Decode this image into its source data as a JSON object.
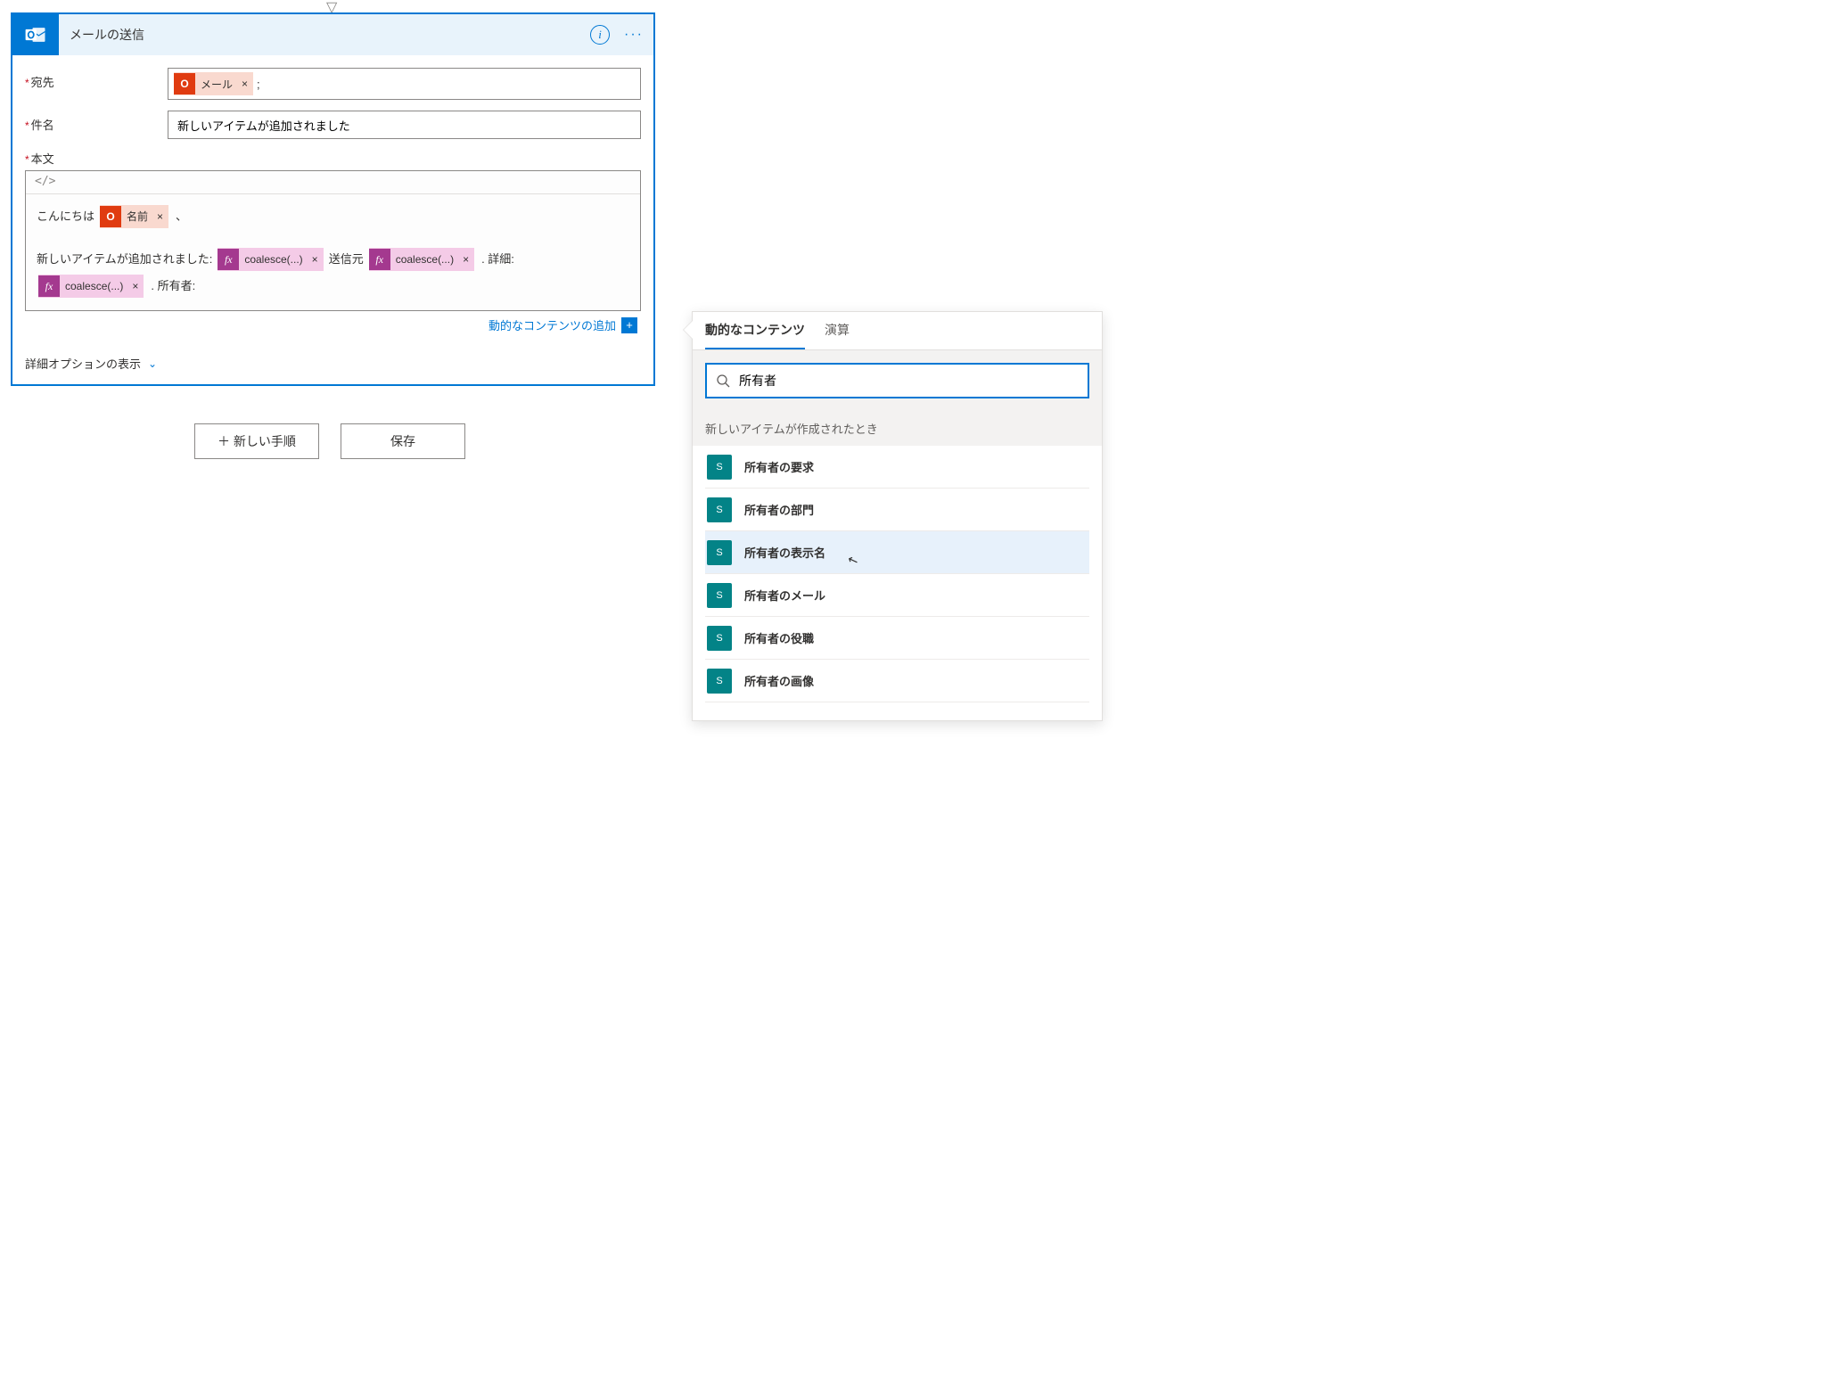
{
  "arrow_char": "▽",
  "action": {
    "title": "メールの送信",
    "info_content": "i",
    "menu_dots": "···",
    "labels": {
      "to": "宛先",
      "subject": "件名",
      "body": "本文"
    },
    "to_token": {
      "label": "メール"
    },
    "to_suffix": ";",
    "subject_value": "新しいアイテムが追加されました",
    "body": {
      "toolbar_code": "</>",
      "line1_prefix": "こんにちは",
      "line1_token": "名前",
      "line1_suffix": "、",
      "line2_prefix": "新しいアイテムが追加されました:",
      "line2_fx1": "coalesce(...)",
      "line2_mid": "送信元",
      "line2_fx2": "coalesce(...)",
      "line2_suffix": ". 詳細:",
      "line3_fx": "coalesce(...)",
      "line3_suffix": ". 所有者:"
    },
    "add_dynamic": "動的なコンテンツの追加",
    "advanced": "詳細オプションの表示"
  },
  "footer": {
    "new_step": "＋ 新しい手順",
    "save": "保存"
  },
  "picker": {
    "tabs": {
      "dynamic": "動的なコンテンツ",
      "expression": "演算"
    },
    "search_value": "所有者",
    "section": "新しいアイテムが作成されたとき",
    "items": [
      {
        "label": "所有者の要求",
        "hover": false
      },
      {
        "label": "所有者の部門",
        "hover": false
      },
      {
        "label": "所有者の表示名",
        "hover": true
      },
      {
        "label": "所有者のメール",
        "hover": false
      },
      {
        "label": "所有者の役職",
        "hover": false
      },
      {
        "label": "所有者の画像",
        "hover": false
      }
    ]
  }
}
